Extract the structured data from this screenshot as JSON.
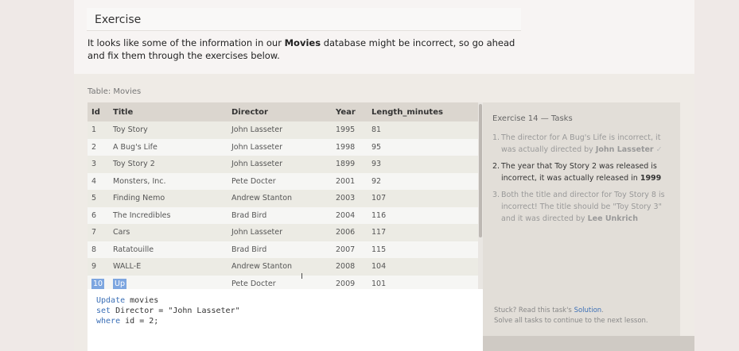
{
  "exercise": {
    "heading": "Exercise",
    "intro_prefix": "It looks like some of the information in our ",
    "intro_bold": "Movies",
    "intro_suffix": " database might be incorrect, so go ahead and fix them through the exercises below."
  },
  "table": {
    "caption": "Table: Movies",
    "columns": [
      "Id",
      "Title",
      "Director",
      "Year",
      "Length_minutes"
    ],
    "rows": [
      [
        "1",
        "Toy Story",
        "John Lasseter",
        "1995",
        "81"
      ],
      [
        "2",
        "A Bug's Life",
        "John Lasseter",
        "1998",
        "95"
      ],
      [
        "3",
        "Toy Story 2",
        "John Lasseter",
        "1899",
        "93"
      ],
      [
        "4",
        "Monsters, Inc.",
        "Pete Docter",
        "2001",
        "92"
      ],
      [
        "5",
        "Finding Nemo",
        "Andrew Stanton",
        "2003",
        "107"
      ],
      [
        "6",
        "The Incredibles",
        "Brad Bird",
        "2004",
        "116"
      ],
      [
        "7",
        "Cars",
        "John Lasseter",
        "2006",
        "117"
      ],
      [
        "8",
        "Ratatouille",
        "Brad Bird",
        "2007",
        "115"
      ],
      [
        "9",
        "WALL-E",
        "Andrew Stanton",
        "2008",
        "104"
      ],
      [
        "10",
        "Up",
        "Pete Docter",
        "2009",
        "101"
      ]
    ]
  },
  "editor": {
    "line1_kw": "Update",
    "line1_rest": " movies",
    "line2_kw": "set",
    "line2_rest": " Director = ",
    "line2_str": "\"John Lasseter\"",
    "line3_kw": "where",
    "line3_rest": " id = 2;"
  },
  "tasks": {
    "title": "Exercise 14 — Tasks",
    "items": [
      {
        "num": "1.",
        "text": "The director for A Bug's Life is incorrect, it was actually directed by ",
        "bold": "John Lasseter",
        "check": "✓"
      },
      {
        "num": "2.",
        "text": "The year that Toy Story 2 was released is incorrect, it was actually released in ",
        "bold": "1999"
      },
      {
        "num": "3.",
        "text": "Both the title and director for Toy Story 8 is incorrect! The title should be \"Toy Story 3\" and it was directed by ",
        "bold": "Lee Unkrich"
      }
    ],
    "footer_prefix": "Stuck? Read this task's ",
    "footer_link": "Solution",
    "footer_suffix": ".",
    "footer_line2": "Solve all tasks to continue to the next lesson."
  },
  "colors": {
    "page_bg": "#efe9e7",
    "panel_bg": "#efebe6",
    "header_row": "#dbd6cf",
    "selection": "#7da6e0",
    "keyword": "#3b6fb6"
  }
}
